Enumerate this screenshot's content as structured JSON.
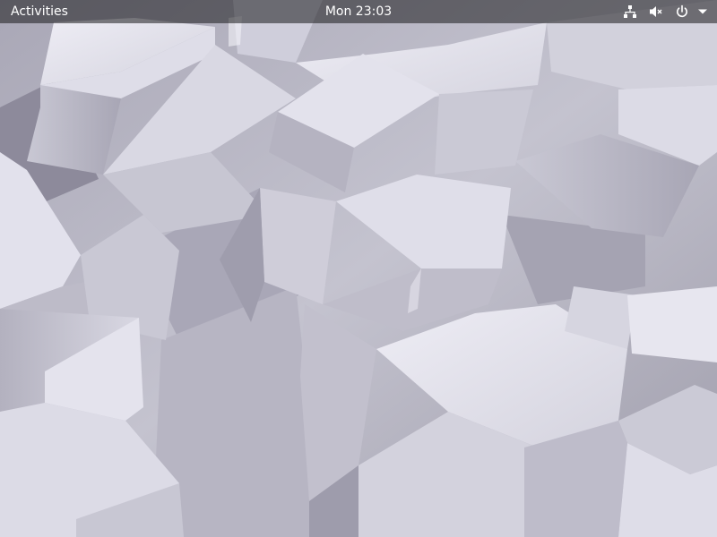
{
  "top_bar": {
    "activities_label": "Activities",
    "clock_text": "Mon 23:03"
  },
  "status_icons": [
    "network-wired-icon",
    "audio-muted-icon",
    "power-icon",
    "system-menu-arrow-icon"
  ],
  "colors": {
    "panel_background": "#1c1c1f",
    "panel_text": "#ffffff",
    "wallpaper_light": "#e6e5ef",
    "wallpaper_mid": "#c7c6d2",
    "wallpaper_dark": "#8e8b9b"
  }
}
